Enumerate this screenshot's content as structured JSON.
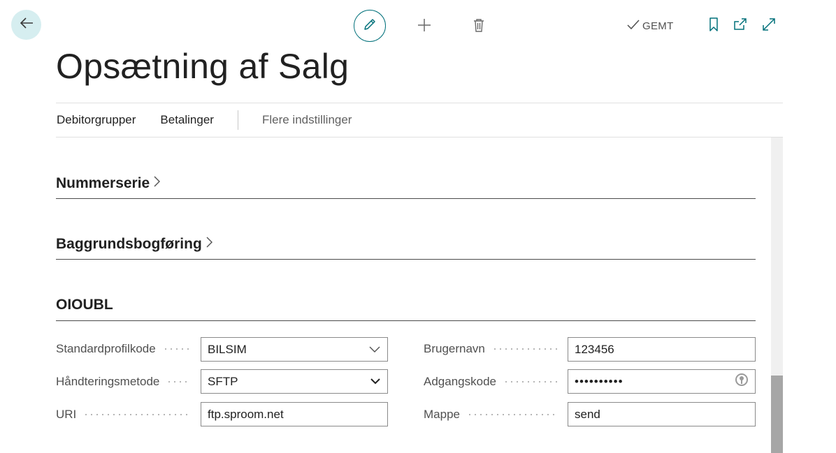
{
  "header": {
    "saved_label": "GEMT",
    "page_title": "Opsætning af Salg"
  },
  "icons": {
    "back": "arrow-left-icon",
    "edit": "pencil-icon",
    "new": "plus-icon",
    "delete": "trash-icon",
    "saved": "check-icon",
    "bookmark": "bookmark-icon",
    "open_new_window": "open-in-new-window-icon",
    "expand": "expand-icon"
  },
  "tabs": {
    "debitorgrupper": "Debitorgrupper",
    "betalinger": "Betalinger",
    "flere": "Flere indstillinger"
  },
  "sections": {
    "nummerserie": "Nummerserie",
    "baggrund": "Baggrundsbogføring",
    "oioubl": "OIOUBL"
  },
  "fields": {
    "standardprofilkode": {
      "label": "Standardprofilkode",
      "value": "BILSIM"
    },
    "haandteringsmetode": {
      "label": "Håndteringsmetode",
      "value": "SFTP"
    },
    "uri": {
      "label": "URI",
      "value": "ftp.sproom.net"
    },
    "brugernavn": {
      "label": "Brugernavn",
      "value": "123456"
    },
    "adgangskode": {
      "label": "Adgangskode",
      "value": "••••••••••"
    },
    "mappe": {
      "label": "Mappe",
      "value": "send"
    }
  },
  "colors": {
    "accent": "#00707a",
    "back_button_bg": "#d6eef0"
  }
}
